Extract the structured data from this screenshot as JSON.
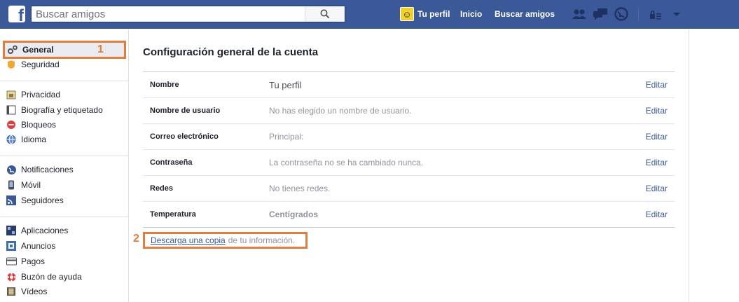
{
  "topbar": {
    "logo": "f",
    "search_placeholder": "Buscar amigos",
    "profile_label": "Tu perfil",
    "inicio_label": "Inicio",
    "buscar_label": "Buscar amigos"
  },
  "sidebar": {
    "items": [
      {
        "label": "General",
        "icon": "gears-icon"
      },
      {
        "label": "Seguridad",
        "icon": "badge-icon"
      },
      {
        "label": "Privacidad",
        "icon": "lock-icon"
      },
      {
        "label": "Biografía y etiquetado",
        "icon": "timeline-icon"
      },
      {
        "label": "Bloqueos",
        "icon": "block-icon"
      },
      {
        "label": "Idioma",
        "icon": "globe-icon"
      },
      {
        "label": "Notificaciones",
        "icon": "earth-icon"
      },
      {
        "label": "Móvil",
        "icon": "mobile-icon"
      },
      {
        "label": "Seguidores",
        "icon": "rss-icon"
      },
      {
        "label": "Aplicaciones",
        "icon": "apps-icon"
      },
      {
        "label": "Anuncios",
        "icon": "ads-icon"
      },
      {
        "label": "Pagos",
        "icon": "card-icon"
      },
      {
        "label": "Buzón de ayuda",
        "icon": "lifebuoy-icon"
      },
      {
        "label": "Vídeos",
        "icon": "film-icon"
      }
    ],
    "marker": "1"
  },
  "main": {
    "title": "Configuración general de la cuenta",
    "rows": [
      {
        "label": "Nombre",
        "value": "Tu perfil",
        "edit": "Editar"
      },
      {
        "label": "Nombre de usuario",
        "value": "No has elegido un nombre de usuario.",
        "edit": "Editar"
      },
      {
        "label": "Correo electrónico",
        "value": "Principal:",
        "edit": "Editar"
      },
      {
        "label": "Contraseña",
        "value": "La contraseña no se ha cambiado nunca.",
        "edit": "Editar"
      },
      {
        "label": "Redes",
        "value": "No tienes redes.",
        "edit": "Editar"
      },
      {
        "label": "Temperatura",
        "value": "Centígrados",
        "edit": "Editar"
      }
    ],
    "download_link": "Descarga una copia",
    "download_rest": "de tu información.",
    "marker": "2"
  },
  "colors": {
    "brand": "#3b5998",
    "highlight": "#e27c3f",
    "link": "#365899"
  }
}
